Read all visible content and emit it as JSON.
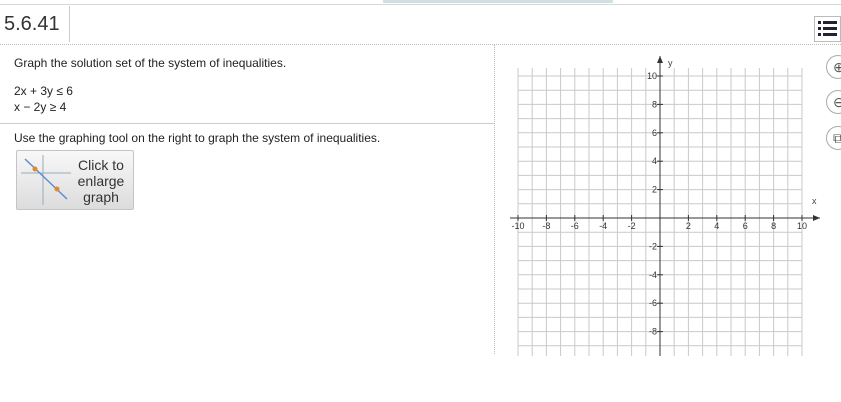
{
  "question": {
    "number": "5.6.41",
    "prompt": "Graph the solution set of the system of inequalities.",
    "equations": [
      "2x + 3y ≤ 6",
      "x − 2y ≥ 4"
    ],
    "instruction": "Use the graphing tool on the right to graph the system of inequalities."
  },
  "enlarge_button": {
    "lines": [
      "Click to",
      "enlarge",
      "graph"
    ]
  },
  "graph": {
    "x_label": "x",
    "y_label": "y",
    "x_ticks": [
      "-10",
      "-8",
      "-6",
      "-4",
      "-2",
      "2",
      "4",
      "6",
      "8",
      "10"
    ],
    "y_ticks": [
      "10",
      "8",
      "6",
      "4",
      "2",
      "-2",
      "-4",
      "-6",
      "-8"
    ],
    "x_range": [
      -10,
      10
    ],
    "y_range": [
      -10,
      10
    ],
    "grid": true
  },
  "tools": [
    "zoom-in",
    "zoom-out",
    "pop-out"
  ]
}
